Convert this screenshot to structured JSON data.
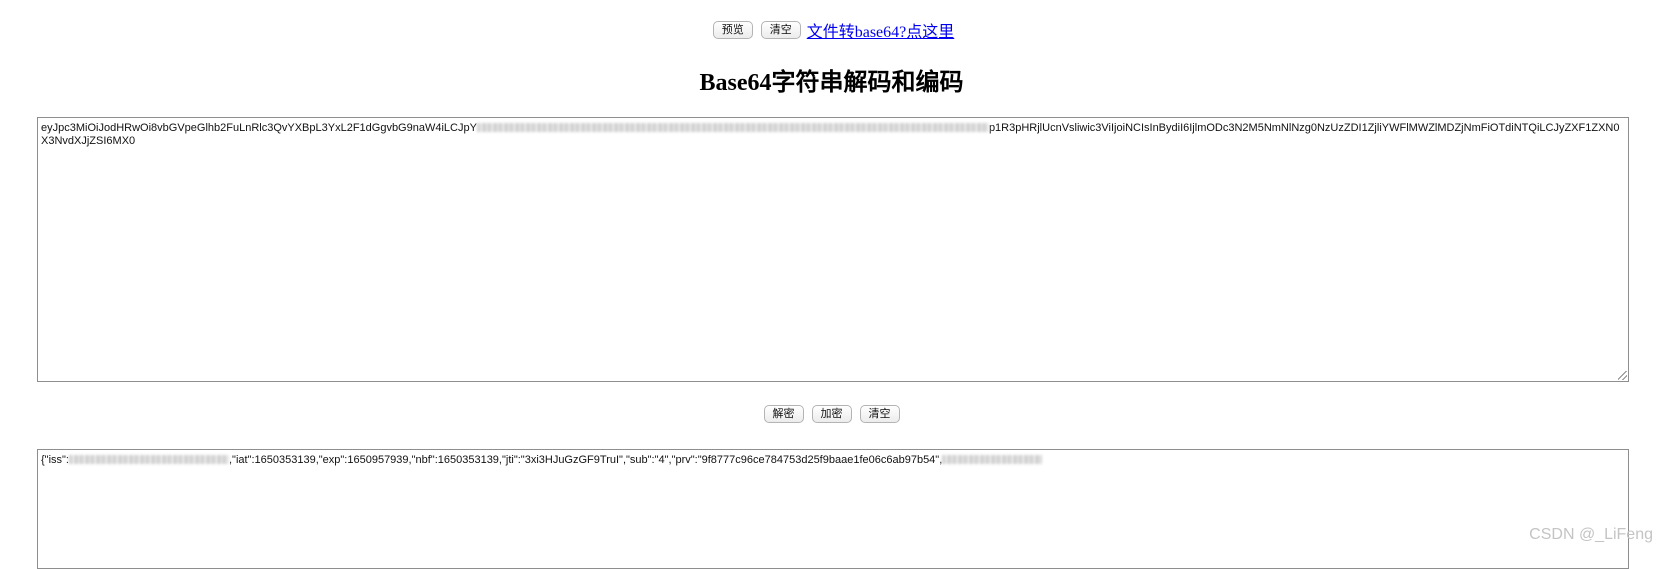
{
  "toolbar": {
    "preview_label": "预览",
    "clear_label": "清空",
    "file_link_label": "文件转base64?点这里"
  },
  "page": {
    "title": "Base64字符串解码和编码"
  },
  "input": {
    "text_start": "eyJpc3MiOiJodHRwOi8vbGVpeGlhb2FuLnRlc3QvYXBpL3YxL2F1dGgvbG9naW4iLCJpY",
    "text_end": "p1R3pHRjlUcnVsliwic3ViIjoiNCIsInBydiI6IjlmODc3N2M5NmNlNzg0NzUzZDI1ZjliYWFlMWZlMDZjNmFiOTdiNTQiLCJyZXF1ZXN0X3NvdXJjZSI6MX0"
  },
  "actions": {
    "decode_label": "解密",
    "encode_label": "加密",
    "clear_label": "清空"
  },
  "output": {
    "text_start": "{\"iss\":",
    "text_middle": ",\"iat\":1650353139,\"exp\":1650957939,\"nbf\":1650353139,\"jti\":\"3xi3HJuGzGF9TruI\",\"sub\":\"4\",\"prv\":\"9f8777c96ce784753d25f9baae1fe06c6ab97b54\","
  },
  "watermark": {
    "text": "CSDN @_LiFeng"
  }
}
